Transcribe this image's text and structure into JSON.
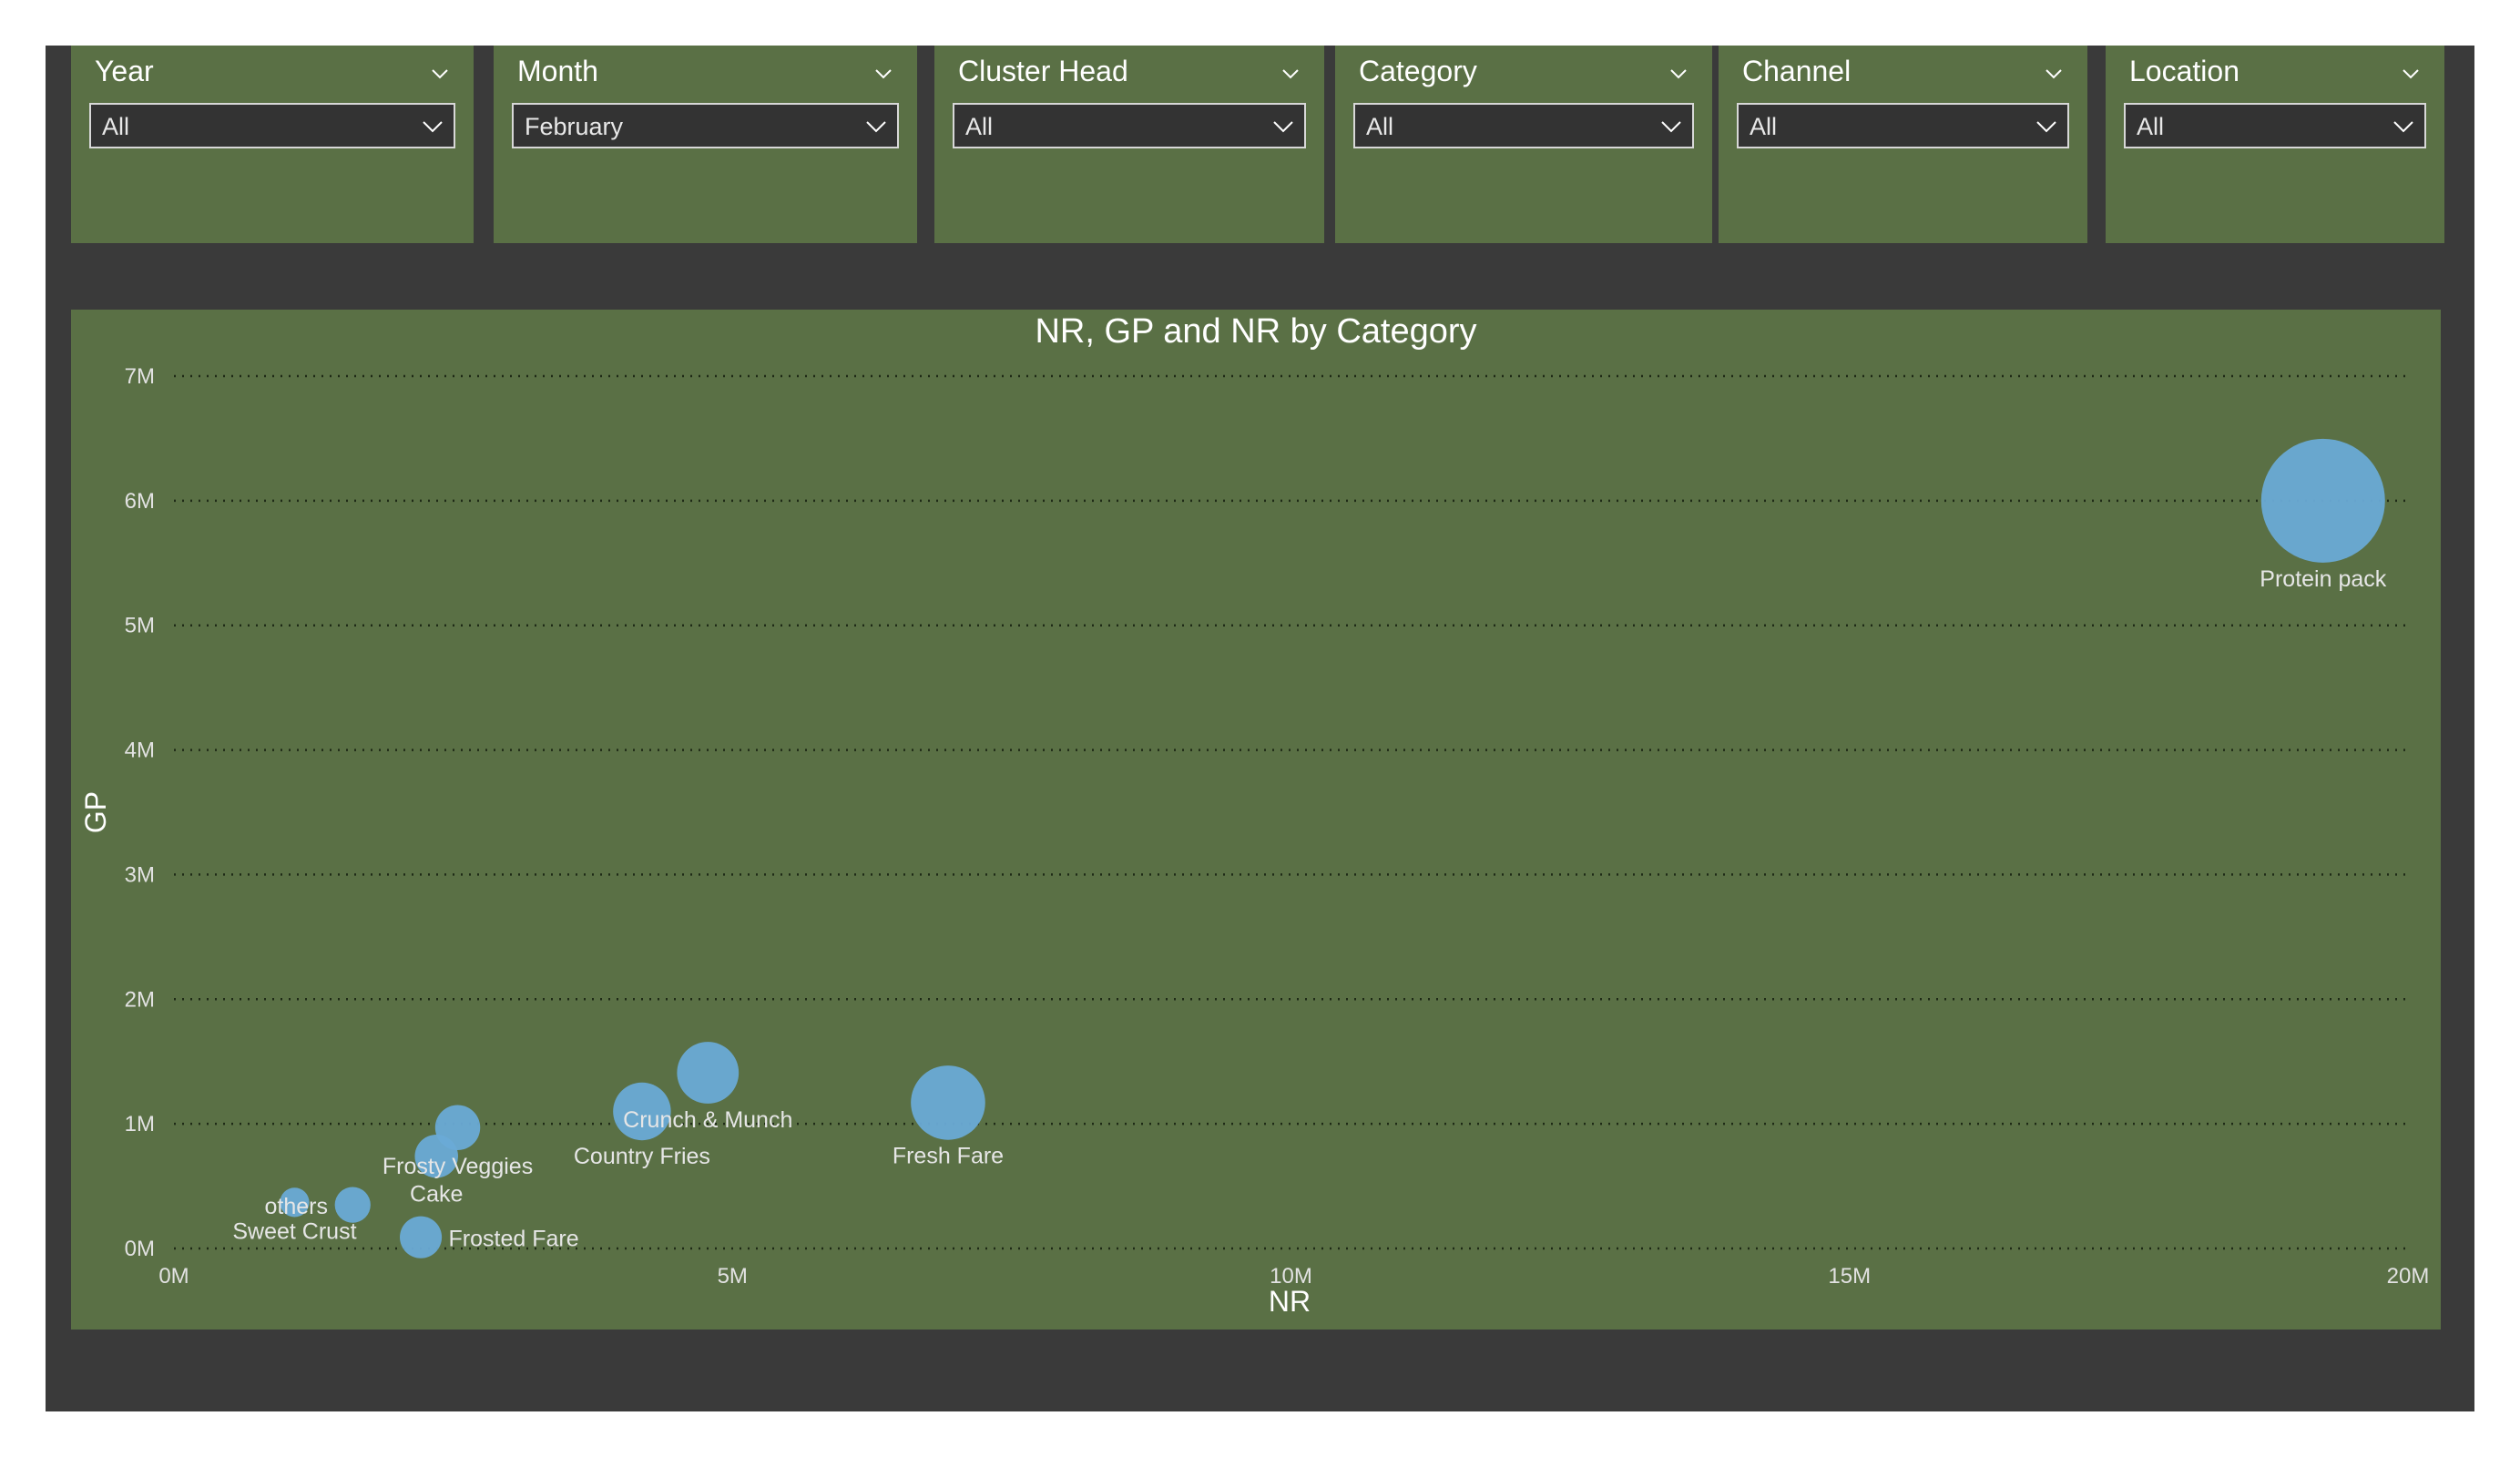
{
  "slicers": [
    {
      "title": "Year",
      "value": "All"
    },
    {
      "title": "Month",
      "value": "February"
    },
    {
      "title": "Cluster Head",
      "value": "All"
    },
    {
      "title": "Category",
      "value": "All"
    },
    {
      "title": "Channel",
      "value": "All"
    },
    {
      "title": "Location",
      "value": "All"
    }
  ],
  "colors": {
    "panel": "#5a7045",
    "background": "#3a3a3a",
    "bubble": "#6aaad6"
  },
  "chart_data": {
    "type": "scatter",
    "title": "NR, GP and NR by Category",
    "xlabel": "NR",
    "ylabel": "GP",
    "xlim": [
      0,
      20000000
    ],
    "ylim": [
      0,
      7000000
    ],
    "x_ticks": [
      {
        "value": 0,
        "label": "0M"
      },
      {
        "value": 5000000,
        "label": "5M"
      },
      {
        "value": 10000000,
        "label": "10M"
      },
      {
        "value": 15000000,
        "label": "15M"
      },
      {
        "value": 20000000,
        "label": "20M"
      }
    ],
    "y_ticks": [
      {
        "value": 0,
        "label": "0M"
      },
      {
        "value": 1000000,
        "label": "1M"
      },
      {
        "value": 2000000,
        "label": "2M"
      },
      {
        "value": 3000000,
        "label": "3M"
      },
      {
        "value": 4000000,
        "label": "4M"
      },
      {
        "value": 5000000,
        "label": "5M"
      },
      {
        "value": 6000000,
        "label": "6M"
      },
      {
        "value": 7000000,
        "label": "7M"
      }
    ],
    "grid": "horizontal dotted",
    "size_field": "NR",
    "points": [
      {
        "label": "Protein pack",
        "x": 19240000,
        "y": 6000000,
        "size": 19240000
      },
      {
        "label": "Fresh Fare",
        "x": 6930000,
        "y": 1170000,
        "size": 6930000
      },
      {
        "label": "Crunch & Munch",
        "x": 4780000,
        "y": 1410000,
        "size": 4780000
      },
      {
        "label": "Country Fries",
        "x": 4190000,
        "y": 1100000,
        "size": 4190000
      },
      {
        "label": "Frosty Veggies",
        "x": 2540000,
        "y": 970000,
        "size": 2540000
      },
      {
        "label": "Cake",
        "x": 2350000,
        "y": 740000,
        "size": 2350000
      },
      {
        "label": "Frosted Fare",
        "x": 2210000,
        "y": 90000,
        "size": 2210000
      },
      {
        "label": "others",
        "x": 1600000,
        "y": 350000,
        "size": 1600000
      },
      {
        "label": "Sweet Crust",
        "x": 1080000,
        "y": 370000,
        "size": 1080000
      }
    ]
  }
}
